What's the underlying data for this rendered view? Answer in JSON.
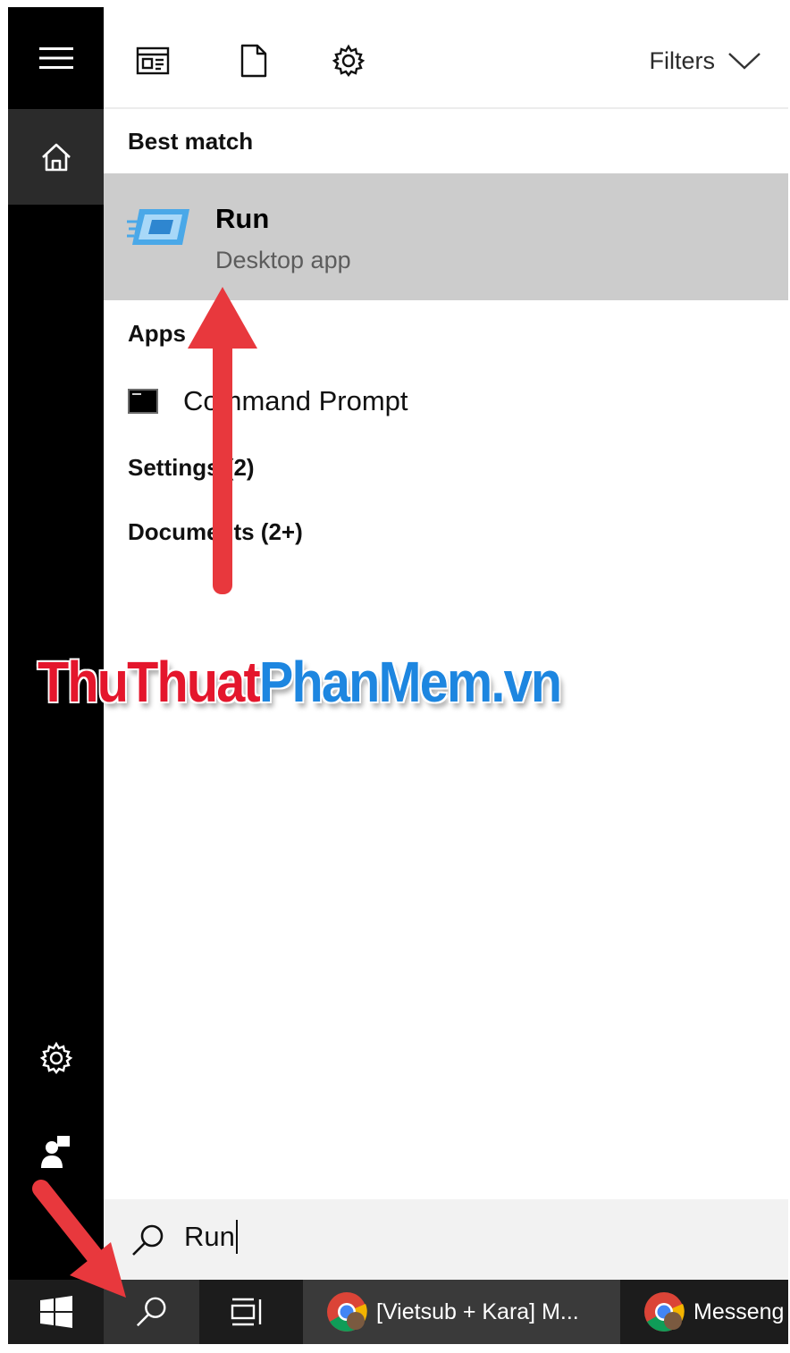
{
  "toolbar": {
    "filters_label": "Filters",
    "icons": [
      "apps-layout-icon",
      "document-icon",
      "settings-gear-icon",
      "chevron-down-icon"
    ]
  },
  "sections": {
    "best_match": "Best match",
    "apps": "Apps",
    "settings": "Settings (2)",
    "documents": "Documents (2+)"
  },
  "best_match_item": {
    "title": "Run",
    "subtitle": "Desktop app",
    "icon": "run-app-icon"
  },
  "apps_items": [
    {
      "label": "Command Prompt",
      "icon": "command-prompt-icon"
    }
  ],
  "watermark": {
    "part1": "ThuThuat",
    "part2": "PhanMem.vn"
  },
  "search": {
    "value": "Run"
  },
  "taskbar": {
    "tasks": [
      {
        "label": "[Vietsub + Kara] M...",
        "icon": "chrome-icon",
        "active": true
      },
      {
        "label": "Messeng",
        "icon": "chrome-icon",
        "active": false
      }
    ]
  },
  "colors": {
    "rail_bg": "#000000",
    "selected_row": "#cccccc",
    "taskbar_bg": "#1c1c1c",
    "annotation_arrow": "#e8383d",
    "watermark_red": "#e4162c",
    "watermark_blue": "#1d86e0"
  }
}
